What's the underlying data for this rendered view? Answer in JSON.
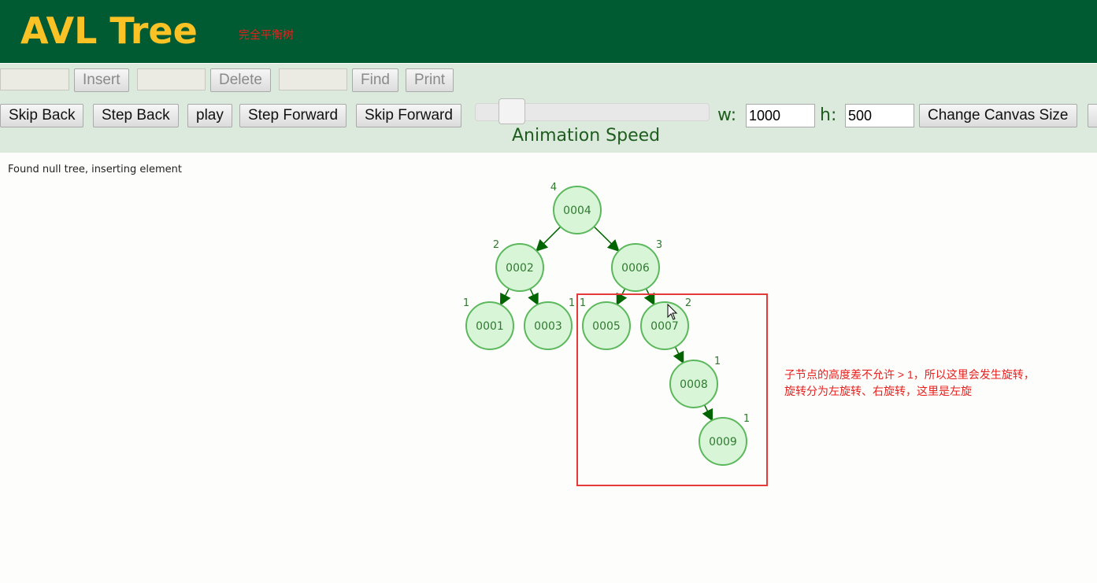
{
  "header": {
    "title": "AVL Tree",
    "subtitle": "完全平衡树"
  },
  "controls": {
    "insert_input": "",
    "insert_label": "Insert",
    "delete_input": "",
    "delete_label": "Delete",
    "find_input": "",
    "find_label": "Find",
    "print_label": "Print",
    "skip_back": "Skip Back",
    "step_back": "Step Back",
    "play": "play",
    "step_forward": "Step Forward",
    "skip_forward": "Skip Forward",
    "animation_speed_label": "Animation Speed",
    "animation_speed_value": 0.1,
    "w_label": "w:",
    "w_value": "1000",
    "h_label": "h:",
    "h_value": "500",
    "change_canvas": "Change Canvas Size"
  },
  "status": "Found null tree, inserting element",
  "annotation": {
    "line1": "子节点的高度差不允许 > 1，所以这里会发生旋转，",
    "line2": "旋转分为左旋转、右旋转，这里是左旋"
  },
  "colors": {
    "header": "#005a32",
    "title": "#fbc226",
    "node_fill": "#d8f5d8",
    "node_stroke": "#5cb85c",
    "edge": "#006400",
    "highlight": "#e53a3a"
  },
  "tree": {
    "nodes": [
      {
        "id": "0004",
        "height": "4"
      },
      {
        "id": "0002",
        "height": "2"
      },
      {
        "id": "0006",
        "height": "3"
      },
      {
        "id": "0001",
        "height": "1"
      },
      {
        "id": "0003",
        "height": "1"
      },
      {
        "id": "0005",
        "height": "1"
      },
      {
        "id": "0007",
        "height": "2"
      },
      {
        "id": "0008",
        "height": "1"
      },
      {
        "id": "0009",
        "height": "1"
      }
    ],
    "edges": [
      [
        "0004",
        "0002"
      ],
      [
        "0004",
        "0006"
      ],
      [
        "0002",
        "0001"
      ],
      [
        "0002",
        "0003"
      ],
      [
        "0006",
        "0005"
      ],
      [
        "0006",
        "0007"
      ],
      [
        "0007",
        "0008"
      ],
      [
        "0008",
        "0009"
      ]
    ]
  }
}
